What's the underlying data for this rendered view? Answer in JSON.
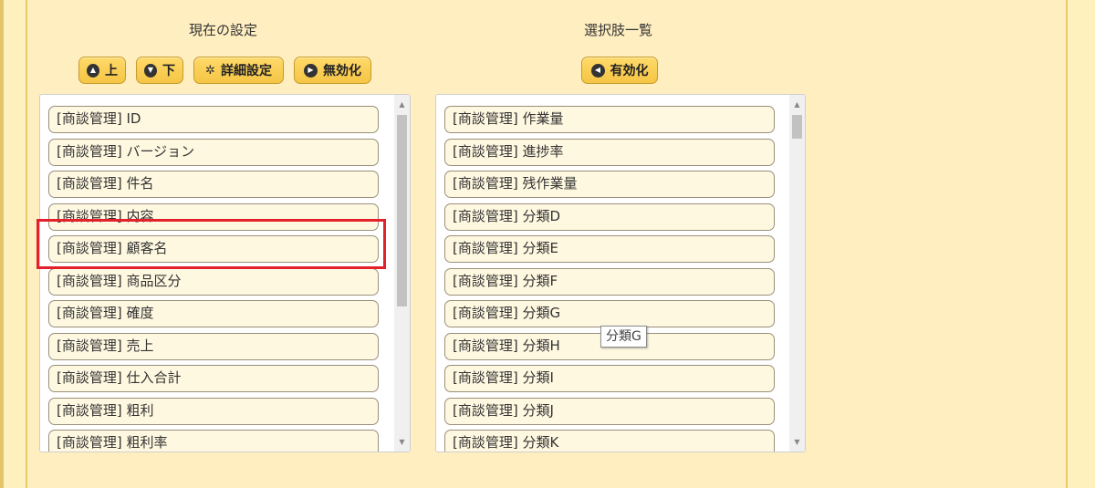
{
  "current": {
    "title": "現在の設定",
    "buttons": {
      "up": "上",
      "down": "下",
      "detail": "詳細設定",
      "disable": "無効化"
    },
    "items": [
      "[商談管理] ID",
      "[商談管理] バージョン",
      "[商談管理] 件名",
      "[商談管理] 内容",
      "[商談管理] 顧客名",
      "[商談管理] 商品区分",
      "[商談管理] 確度",
      "[商談管理] 売上",
      "[商談管理] 仕入合計",
      "[商談管理] 粗利",
      "[商談管理] 粗利率"
    ]
  },
  "options": {
    "title": "選択肢一覧",
    "buttons": {
      "enable": "有効化"
    },
    "items": [
      "[商談管理] 作業量",
      "[商談管理] 進捗率",
      "[商談管理] 残作業量",
      "[商談管理] 分類D",
      "[商談管理] 分類E",
      "[商談管理] 分類F",
      "[商談管理] 分類G",
      "[商談管理] 分類H",
      "[商談管理] 分類I",
      "[商談管理] 分類J",
      "[商談管理] 分類K"
    ]
  },
  "tooltip": "分類G",
  "colors": {
    "accent": "#f5c545",
    "highlight": "#e3212b"
  }
}
